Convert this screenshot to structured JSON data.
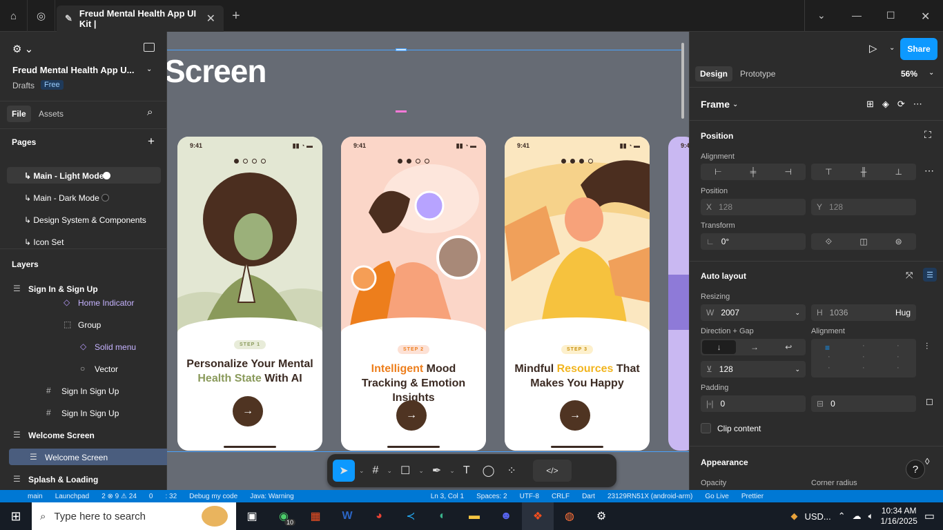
{
  "titlebar": {
    "tab_title": "Freud Mental Health App UI Kit |",
    "home_icon": "home-icon",
    "globe_icon": "globe-icon",
    "tab_close": "✕",
    "new_tab": "+"
  },
  "left_panel": {
    "file_name": "Freud Mental Health App U...",
    "drafts": "Drafts",
    "plan_badge": "Free",
    "tabs": [
      "File",
      "Assets"
    ],
    "pages_heading": "Pages",
    "pages": [
      {
        "label": "↳ Main - Light Mode",
        "dot": "light"
      },
      {
        "label": "↳ Main - Dark Mode",
        "dot": "dark"
      },
      {
        "label": "↳ Design System & Components"
      },
      {
        "label": "↳ Icon Set"
      }
    ],
    "layers_heading": "Layers",
    "layers": [
      {
        "label": "Sign In & Sign Up",
        "bold": true,
        "indent": 0,
        "icon": "section-icon"
      },
      {
        "label": "Home Indicator",
        "indent": 2,
        "icon": "component-icon",
        "purple": true
      },
      {
        "label": "Group",
        "indent": 2,
        "icon": "group-icon"
      },
      {
        "label": "Solid menu",
        "indent": 3,
        "icon": "component-icon",
        "purple": true
      },
      {
        "label": "Vector",
        "indent": 3,
        "icon": "vector-icon"
      },
      {
        "label": "Sign In Sign Up",
        "indent": 1,
        "icon": "frame-icon"
      },
      {
        "label": "Sign In Sign Up",
        "indent": 1,
        "icon": "frame-icon"
      },
      {
        "label": "Welcome Screen",
        "bold": true,
        "indent": 0,
        "icon": "section-icon"
      },
      {
        "label": "Welcome Screen",
        "indent": 1,
        "icon": "section-icon",
        "selected": true
      },
      {
        "label": "Splash & Loading",
        "bold": true,
        "indent": 0,
        "icon": "section-icon"
      }
    ]
  },
  "canvas": {
    "heading": "Screen",
    "phones": [
      {
        "time": "9:41",
        "step": "STEP 1",
        "title_parts": [
          "Personalize Your Mental ",
          "Health State",
          " With AI"
        ],
        "accent": "#8a9a5b",
        "step_bg": "#e8ecd9",
        "step_fg": "#8a9a5b",
        "bg": "#e3e7d3",
        "active_dot": 0
      },
      {
        "time": "9:41",
        "step": "STEP 2",
        "title_parts": [
          "",
          "Intelligent",
          " Mood Tracking & Emotion Insights"
        ],
        "accent": "#ed7e1c",
        "step_bg": "#fde1d5",
        "step_fg": "#ed7e1c",
        "bg": "#fbd6c8",
        "active_dot": 1
      },
      {
        "time": "9:41",
        "step": "STEP 3",
        "title_parts": [
          "Mindful ",
          "Resources",
          " That Makes You Happy"
        ],
        "accent": "#f2b51f",
        "step_bg": "#fdf0cc",
        "step_fg": "#c98f08",
        "bg": "#fbe7c0",
        "active_dot": 2
      }
    ],
    "next_arrow": "→"
  },
  "toolbar": {
    "code_icon": "</>"
  },
  "right_panel": {
    "tabs": [
      "Design",
      "Prototype"
    ],
    "zoom": "56%",
    "share_label": "Share",
    "frame_label": "Frame",
    "position_heading": "Position",
    "alignment_label": "Alignment",
    "position_label": "Position",
    "x_label": "X",
    "x_value": "128",
    "y_label": "Y",
    "y_value": "128",
    "transform_label": "Transform",
    "rotation": "0°",
    "autolayout_heading": "Auto layout",
    "resizing_label": "Resizing",
    "w_label": "W",
    "w_value": "2007",
    "h_label": "H",
    "h_value": "1036",
    "h_mode": "Hug",
    "direction_label": "Direction + Gap",
    "alignment2_label": "Alignment",
    "gap_value": "128",
    "padding_label": "Padding",
    "padding_h": "0",
    "padding_v": "0",
    "clip_label": "Clip content",
    "appearance_heading": "Appearance",
    "opacity_label": "Opacity",
    "corner_label": "Corner radius"
  },
  "statusbar": {
    "items": [
      "main",
      "Launchpad",
      "2 ⊗ 9 ⚠ 24",
      "0",
      ": 32",
      "Debug my code",
      "Java: Warning",
      "Ln 3, Col 1",
      "Spaces: 2",
      "UTF-8",
      "CRLF",
      "Dart",
      "23129RN51X (android-arm)",
      "Go Live",
      "Prettier"
    ]
  },
  "taskbar": {
    "search_placeholder": "Type here to search",
    "whatsapp_badge": "10",
    "currency": "USD...",
    "time": "10:34 AM",
    "date": "1/16/2025"
  }
}
